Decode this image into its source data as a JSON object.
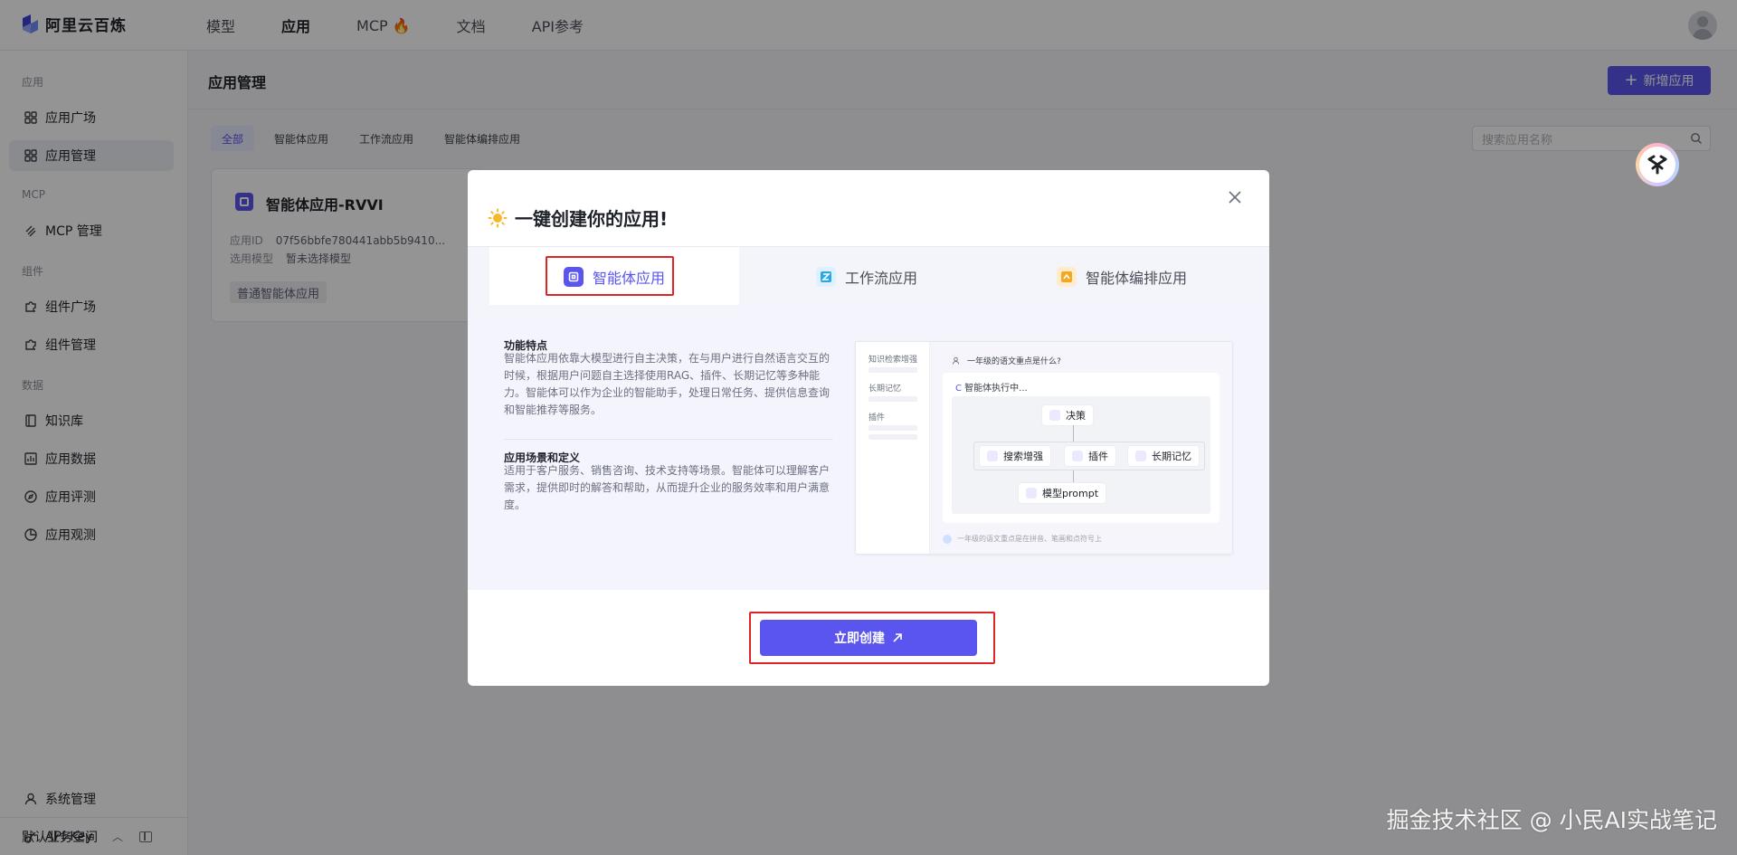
{
  "brand": {
    "name": "阿里云百炼"
  },
  "nav": [
    {
      "label": "模型"
    },
    {
      "label": "应用"
    },
    {
      "label": "MCP 🔥"
    },
    {
      "label": "文档"
    },
    {
      "label": "API参考"
    }
  ],
  "sidebar": {
    "groups": [
      "应用",
      "MCP",
      "组件",
      "数据"
    ],
    "items": [
      {
        "label": "应用广场",
        "icon": "grid-icon"
      },
      {
        "label": "应用管理",
        "icon": "grid-icon"
      },
      {
        "label": "MCP 管理",
        "icon": "mcp-icon"
      },
      {
        "label": "组件广场",
        "icon": "puzzle-icon"
      },
      {
        "label": "组件管理",
        "icon": "puzzle-icon"
      },
      {
        "label": "知识库",
        "icon": "book-icon"
      },
      {
        "label": "应用数据",
        "icon": "chart-icon"
      },
      {
        "label": "应用评测",
        "icon": "compass-icon"
      },
      {
        "label": "应用观测",
        "icon": "pie-icon"
      },
      {
        "label": "系统管理",
        "icon": "user-icon"
      },
      {
        "label": "API-Key",
        "icon": "key-icon"
      }
    ],
    "workspace": "默认业务空间"
  },
  "main": {
    "title": "应用管理",
    "new_button": "新增应用",
    "filters": [
      "全部",
      "智能体应用",
      "工作流应用",
      "智能体编排应用"
    ],
    "search_placeholder": "搜索应用名称",
    "card": {
      "title": "智能体应用-RVVI",
      "id_label": "应用ID",
      "id_value": "07f56bbfe780441abb5b9410...",
      "model_label": "选用模型",
      "model_value": "暂未选择模型",
      "tag": "普通智能体应用"
    }
  },
  "modal": {
    "title": "一键创建你的应用!",
    "tabs": [
      "智能体应用",
      "工作流应用",
      "智能体编排应用"
    ],
    "features_title": "功能特点",
    "features_text": "智能体应用依靠大模型进行自主决策，在与用户进行自然语言交互的时候，根据用户问题自主选择使用RAG、插件、长期记忆等多种能力。智能体可以作为企业的智能助手，处理日常任务、提供信息查询和智能推荐等服务。",
    "scenes_title": "应用场景和定义",
    "scenes_text": "适用于客户服务、销售咨询、技术支持等场景。智能体可以理解客户需求，提供即时的解答和帮助，从而提升企业的服务效率和用户满意度。",
    "preview": {
      "side": [
        "知识检索增强",
        "长期记忆",
        "插件"
      ],
      "question": "一年级的语文重点是什么?",
      "executing": "智能体执行中...",
      "node_decision": "决策",
      "node_search": "搜索增强",
      "node_plugin": "插件",
      "node_memory": "长期记忆",
      "node_prompt": "模型prompt",
      "input_hint": "一年级的语文重点是在拼音、笔画和点符号上"
    },
    "create_button": "立即创建"
  },
  "watermark": "掘金技术社区 @ 小民AI实战笔记",
  "colors": {
    "primary": "#5b55f0",
    "highlight": "#e02424"
  }
}
